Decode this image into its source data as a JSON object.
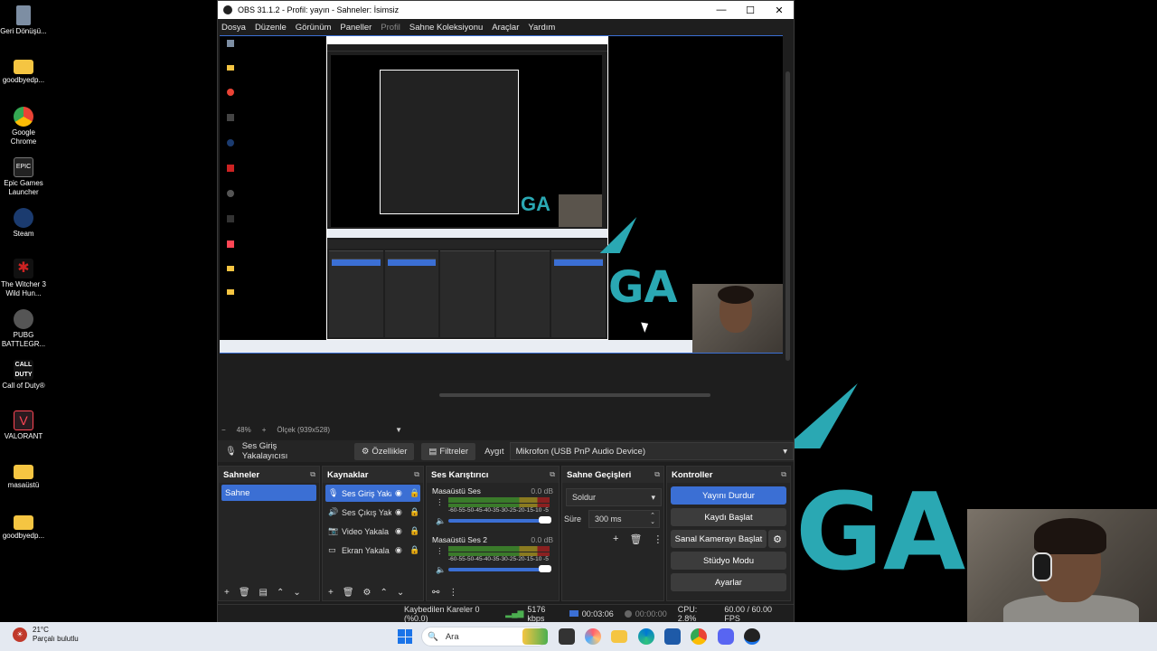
{
  "desktop": {
    "icons": [
      {
        "label": "Geri Dönüşü...",
        "glyph": "recycle-bin"
      },
      {
        "label": "goodbyedp...",
        "glyph": "folder"
      },
      {
        "label": "Google Chrome",
        "glyph": "chrome"
      },
      {
        "label": "Epic Games Launcher",
        "glyph": "epic"
      },
      {
        "label": "Steam",
        "glyph": "steam"
      },
      {
        "label": "The Witcher 3 Wild Hun...",
        "glyph": "witcher"
      },
      {
        "label": "PUBG BATTLEGR...",
        "glyph": "pubg"
      },
      {
        "label": "Call of Duty®",
        "glyph": "cod"
      },
      {
        "label": "VALORANT",
        "glyph": "valorant"
      },
      {
        "label": "masaüstü",
        "glyph": "folder"
      },
      {
        "label": "goodbyedp...",
        "glyph": "folder"
      }
    ],
    "wallpaper_text": "GA",
    "epic_glyph_text": "EPIC",
    "cod_glyph_text": "CALL DUTY"
  },
  "obs": {
    "title": "OBS 31.1.2 - Profil: yayın - Sahneler: İsimsiz",
    "menu": [
      "Dosya",
      "Düzenle",
      "Görünüm",
      "Paneller",
      "Profil",
      "Sahne Koleksiyonu",
      "Araçlar",
      "Yardım"
    ],
    "zoom": "48%",
    "scale_label": "Ölçek (939x528)",
    "source_bar": {
      "source_name": "Ses Giriş Yakalayıcısı",
      "properties": "Özellikler",
      "filters": "Filtreler",
      "device_label": "Aygıt",
      "device_value": "Mikrofon (USB PnP Audio Device)"
    },
    "scenes": {
      "title": "Sahneler",
      "items": [
        "Sahne"
      ]
    },
    "sources": {
      "title": "Kaynaklar",
      "items": [
        {
          "name": "Ses Giriş Yaka",
          "icon": "mic-icon"
        },
        {
          "name": "Ses Çıkış Yaka",
          "icon": "speaker-icon"
        },
        {
          "name": "Video Yakala",
          "icon": "camera-icon"
        },
        {
          "name": "Ekran Yakala",
          "icon": "monitor-icon"
        }
      ]
    },
    "mixer": {
      "title": "Ses Karıştırıcı",
      "channels": [
        {
          "name": "Masaüstü Ses",
          "db": "0.0 dB"
        },
        {
          "name": "Masaüstü Ses 2",
          "db": "0.0 dB"
        }
      ],
      "scale": "-60-55-50-45-40-35-30-25-20-15-10 -5 0"
    },
    "transitions": {
      "title": "Sahne Geçişleri",
      "selected": "Soldur",
      "duration_label": "Süre",
      "duration_value": "300 ms"
    },
    "controls": {
      "title": "Kontroller",
      "stop_stream": "Yayını Durdur",
      "start_record": "Kaydı Başlat",
      "virtual_cam": "Sanal Kamerayı Başlat",
      "studio_mode": "Stüdyo Modu",
      "settings": "Ayarlar"
    },
    "status": {
      "dropped": "Kaybedilen Kareler 0 (%0.0)",
      "bitrate": "5176 kbps",
      "stream_time": "00:03:06",
      "rec_time": "00:00:00",
      "cpu": "CPU: 2.8%",
      "fps": "60.00 / 60.00 FPS"
    }
  },
  "taskbar": {
    "temp": "21°C",
    "weather": "Parçalı bulutlu",
    "search_placeholder": "Ara"
  }
}
